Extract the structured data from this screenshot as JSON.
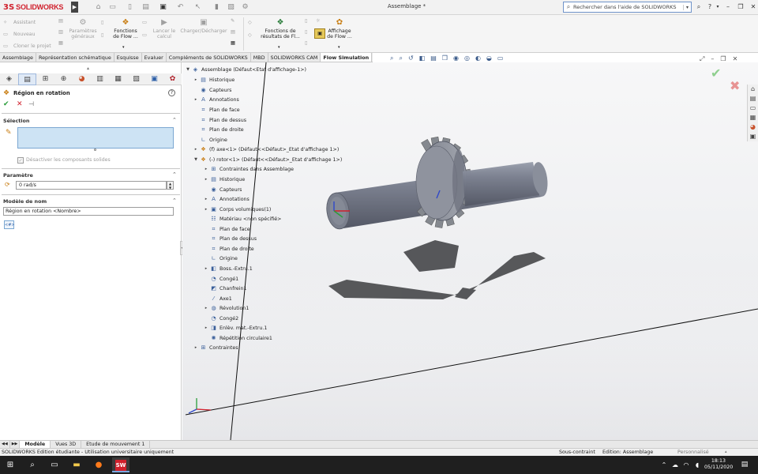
{
  "app": {
    "logo_prefix": "3S",
    "logo_text": "SOLIDWORKS",
    "doc_title": "Assemblage *"
  },
  "search": {
    "placeholder": "Rechercher dans l'aide de SOLIDWORKS"
  },
  "window": {
    "help": "?",
    "minimize": "–",
    "restore": "❐",
    "close": "✕"
  },
  "ribbon": {
    "assistant": "Assistant",
    "nouveau": "Nouveau",
    "cloner": "Cloner le projet",
    "params": [
      "Paramètres",
      "généraux"
    ],
    "fonctions_flow": [
      "Fonctions",
      "de Flow ..."
    ],
    "lancer": [
      "Lancer le",
      "calcul"
    ],
    "charger": "Charger/Décharger",
    "fonctions_resultats": [
      "Fonctions de",
      "résultats de Fl..."
    ],
    "affichage": [
      "Affichage",
      "de Flow ..."
    ]
  },
  "tabs": [
    {
      "label": "Assemblage"
    },
    {
      "label": "Représentation schématique"
    },
    {
      "label": "Esquisse"
    },
    {
      "label": "Evaluer"
    },
    {
      "label": "Compléments de SOLIDWORKS"
    },
    {
      "label": "MBD"
    },
    {
      "label": "SOLIDWORKS CAM"
    },
    {
      "label": "Flow Simulation"
    }
  ],
  "property_manager": {
    "title": "Région en rotation",
    "help": "?",
    "selection_header": "Sélection",
    "disable_components": "Désactiver les composants solides",
    "parameter_header": "Paramètre",
    "parameter_value": "0 rad/s",
    "name_model_header": "Modèle de nom",
    "name_model_value": "Région en rotation <Nombre>"
  },
  "tree": {
    "root": "Assemblage (Défaut<Etat d'affichage-1>)",
    "items": [
      {
        "label": "Historique"
      },
      {
        "label": "Capteurs"
      },
      {
        "label": "Annotations"
      },
      {
        "label": "Plan de face"
      },
      {
        "label": "Plan de dessus"
      },
      {
        "label": "Plan de droite"
      },
      {
        "label": "Origine"
      },
      {
        "label": "(f) axe<1> (Défaut<<Défaut>_Etat d'affichage 1>)"
      },
      {
        "label": "(-) rotor<1> (Défaut<<Défaut>_Etat d'affichage 1>)"
      },
      {
        "label": "Contraintes dans Assemblage"
      },
      {
        "label": "Historique"
      },
      {
        "label": "Capteurs"
      },
      {
        "label": "Annotations"
      },
      {
        "label": "Corps volumiques(1)"
      },
      {
        "label": "Matériau <non spécifié>"
      },
      {
        "label": "Plan de face"
      },
      {
        "label": "Plan de dessus"
      },
      {
        "label": "Plan de droite"
      },
      {
        "label": "Origine"
      },
      {
        "label": "Boss.-Extru.1"
      },
      {
        "label": "Congé1"
      },
      {
        "label": "Chanfrein1"
      },
      {
        "label": "Axe1"
      },
      {
        "label": "Révolution1"
      },
      {
        "label": "Congé2"
      },
      {
        "label": "Enlèv. mat.-Extru.1"
      },
      {
        "label": "Répétition circulaire1"
      },
      {
        "label": "Contraintes"
      }
    ]
  },
  "bottom_tabs": [
    {
      "label": "Modèle"
    },
    {
      "label": "Vues 3D"
    },
    {
      "label": "Etude de mouvement 1"
    }
  ],
  "status": {
    "left": "SOLIDWORKS Edition étudiante - Utilisation universitaire uniquement",
    "constraint": "Sous-contraint",
    "mode": "Edition: Assemblage",
    "units": "Personnalisé"
  },
  "taskbar": {
    "time": "18:13",
    "date": "05/11/2020"
  }
}
